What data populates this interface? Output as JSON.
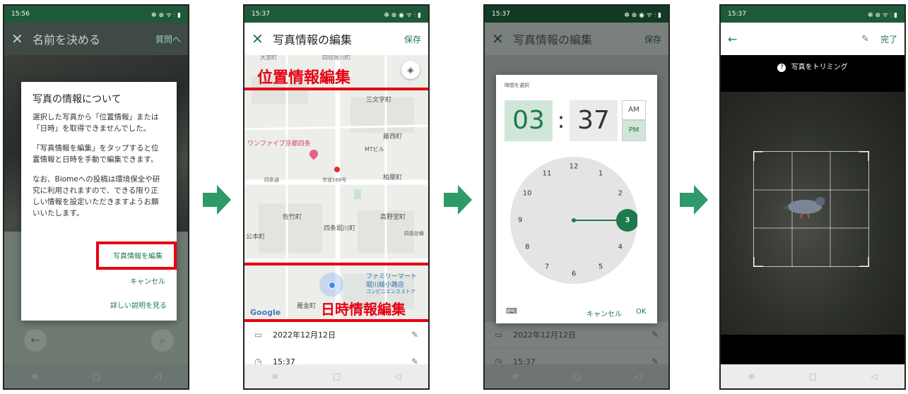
{
  "phone1": {
    "status_time": "15:56",
    "status_icons": "✻ ⊗ ᯤ ⫶ ▮",
    "appbar_title": "名前を決める",
    "appbar_action": "質問へ",
    "dialog": {
      "title": "写真の情報について",
      "para1": "選択した写真から「位置情報」または「日時」を取得できませんでした。",
      "para2": "「写真情報を編集」をタップすると位置情報と日時を手動で編集できます。",
      "para3": "なお、Biomeへの投稿は環境保全や研究に利用されますので、できる限り正しい情報を設定いただきますようお願いいたします。",
      "edit_button": "写真情報を編集",
      "cancel_button": "キャンセル",
      "detail_link": "詳しい説明を見る"
    }
  },
  "phone2": {
    "status_time": "15:37",
    "status_icons": "✻ ⊗ ◉ ᯤ ⫶ ▮",
    "appbar_title": "写真情報の編集",
    "appbar_action": "保存",
    "location_label": "位置情報編集",
    "datetime_label": "日時情報編集",
    "map_labels": {
      "sanmonji": "三文字町",
      "fujinishi": "藤西町",
      "wanfive": "ワンファイブ京都四条",
      "mt_building": "MTビル",
      "kashiwaya": "柏屋町",
      "shijo_dori": "四条通",
      "route": "市道168号",
      "sataka": "佐竹町",
      "takanodo": "高野堂町",
      "shijo_horikawa": "四条堀川町",
      "shijo_shinryo": "四条診療",
      "hommachi": "公本町",
      "familymart": "ファミリーマート",
      "familymart_branch": "堀川綾小路店",
      "familymart_type": "コンビニエンスストア",
      "kanemachi": "雁金町",
      "top_label1": "大宮町",
      "top_label2": "四坊堀川町",
      "google": "Google"
    },
    "date_value": "2022年12月12日",
    "time_value": "15:37"
  },
  "phone3": {
    "status_time": "15:37",
    "status_icons": "✻ ⊗ ◉ ᯤ ⫶ ▮",
    "appbar_title": "写真情報の編集",
    "appbar_action": "保存",
    "picker_caption": "時間を選択",
    "hour": "03",
    "colon": ":",
    "minute": "37",
    "am": "AM",
    "pm": "PM",
    "clock_numbers": [
      "12",
      "1",
      "2",
      "3",
      "4",
      "5",
      "6",
      "7",
      "8",
      "9",
      "10",
      "11"
    ],
    "selected_hour": "3",
    "cancel_button": "キャンセル",
    "ok_button": "OK",
    "date_value": "2022年12月12日",
    "time_value": "15:37"
  },
  "phone4": {
    "status_time": "15:37",
    "status_icons": "✻ ⊗ ᯤ ⫶ ▮",
    "done_button": "完了",
    "trim_hint": "写真をトリミング"
  },
  "colors": {
    "brand_green": "#1e7a4a",
    "status_green": "#1e5a3a",
    "arrow_green": "#2e9a6a",
    "highlight_red": "#e60012"
  }
}
